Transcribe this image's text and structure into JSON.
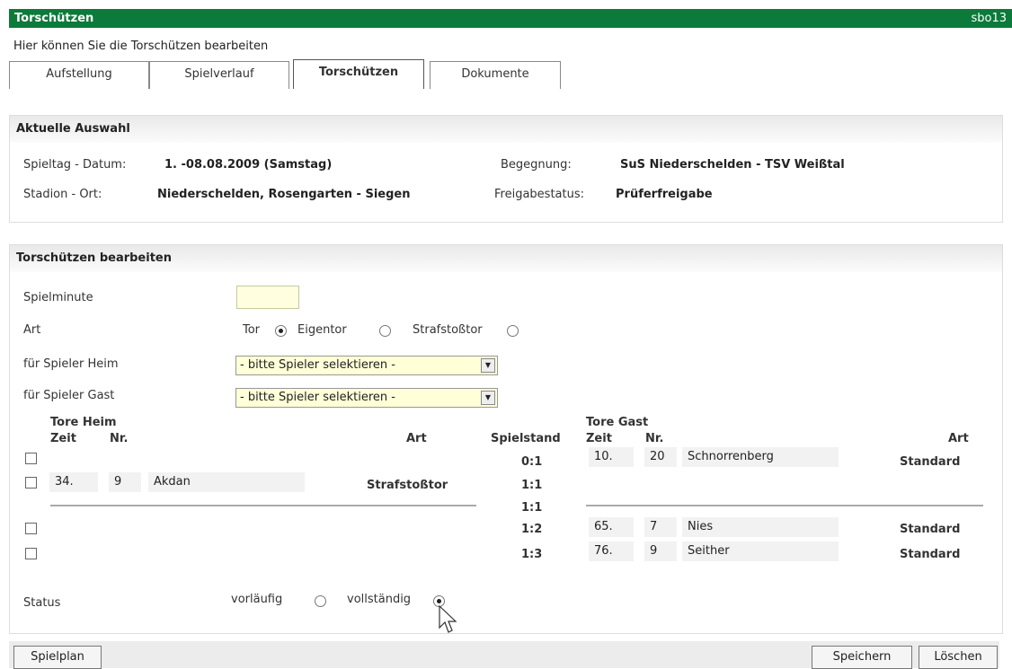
{
  "window": {
    "title": "Torschützen",
    "code": "sbo13"
  },
  "subtitle": "Hier können Sie die Torschützen bearbeiten",
  "tabs": [
    {
      "label": "Aufstellung",
      "active": false
    },
    {
      "label": "Spielverlauf",
      "active": false
    },
    {
      "label": "Torschützen",
      "active": true
    },
    {
      "label": "Dokumente",
      "active": false
    }
  ],
  "selection": {
    "heading": "Aktuelle Auswahl",
    "spieltag_label": "Spieltag - Datum:",
    "spieltag_value": "1. -08.08.2009 (Samstag)",
    "begegnung_label": "Begegnung:",
    "begegnung_value": "SuS Niederschelden - TSV Weißtal",
    "stadion_label": "Stadion - Ort:",
    "stadion_value": "Niederschelden, Rosengarten - Siegen",
    "freigabe_label": "Freigabestatus:",
    "freigabe_value": "Prüferfreigabe"
  },
  "edit": {
    "heading": "Torschützen bearbeiten",
    "minute_label": "Spielminute",
    "minute_value": "",
    "art_label": "Art",
    "art_options": [
      "Tor",
      "Eigentor",
      "Strafstoßtor"
    ],
    "art_selected": "Tor",
    "heim_label": "für Spieler Heim",
    "heim_value": "- bitte Spieler selektieren -",
    "gast_label": "für Spieler Gast",
    "gast_value": "- bitte Spieler selektieren -"
  },
  "table": {
    "heim_heading": "Tore Heim",
    "gast_heading": "Tore Gast",
    "col_zeit": "Zeit",
    "col_nr": "Nr.",
    "col_art": "Art",
    "col_spielstand": "Spielstand",
    "rows": [
      {
        "score": "0:1",
        "heim": null,
        "gast": {
          "zeit": "10.",
          "nr": "20",
          "name": "Schnorrenberg",
          "art": "Standard"
        }
      },
      {
        "score": "1:1",
        "heim": {
          "zeit": "34.",
          "nr": "9",
          "name": "Akdan",
          "art": "Strafstoßtor"
        },
        "gast": null
      },
      {
        "score": "1:1",
        "heim": null,
        "gast": null
      },
      {
        "score": "1:2",
        "heim": null,
        "gast": {
          "zeit": "65.",
          "nr": "7",
          "name": "Nies",
          "art": "Standard"
        }
      },
      {
        "score": "1:3",
        "heim": null,
        "gast": {
          "zeit": "76.",
          "nr": "9",
          "name": "Seither",
          "art": "Standard"
        }
      }
    ]
  },
  "status": {
    "label": "Status",
    "options": [
      "vorläufig",
      "vollständig"
    ],
    "selected": "vollständig"
  },
  "buttons": {
    "spielplan": "Spielplan",
    "speichern": "Speichern",
    "loeschen": "Löschen"
  }
}
